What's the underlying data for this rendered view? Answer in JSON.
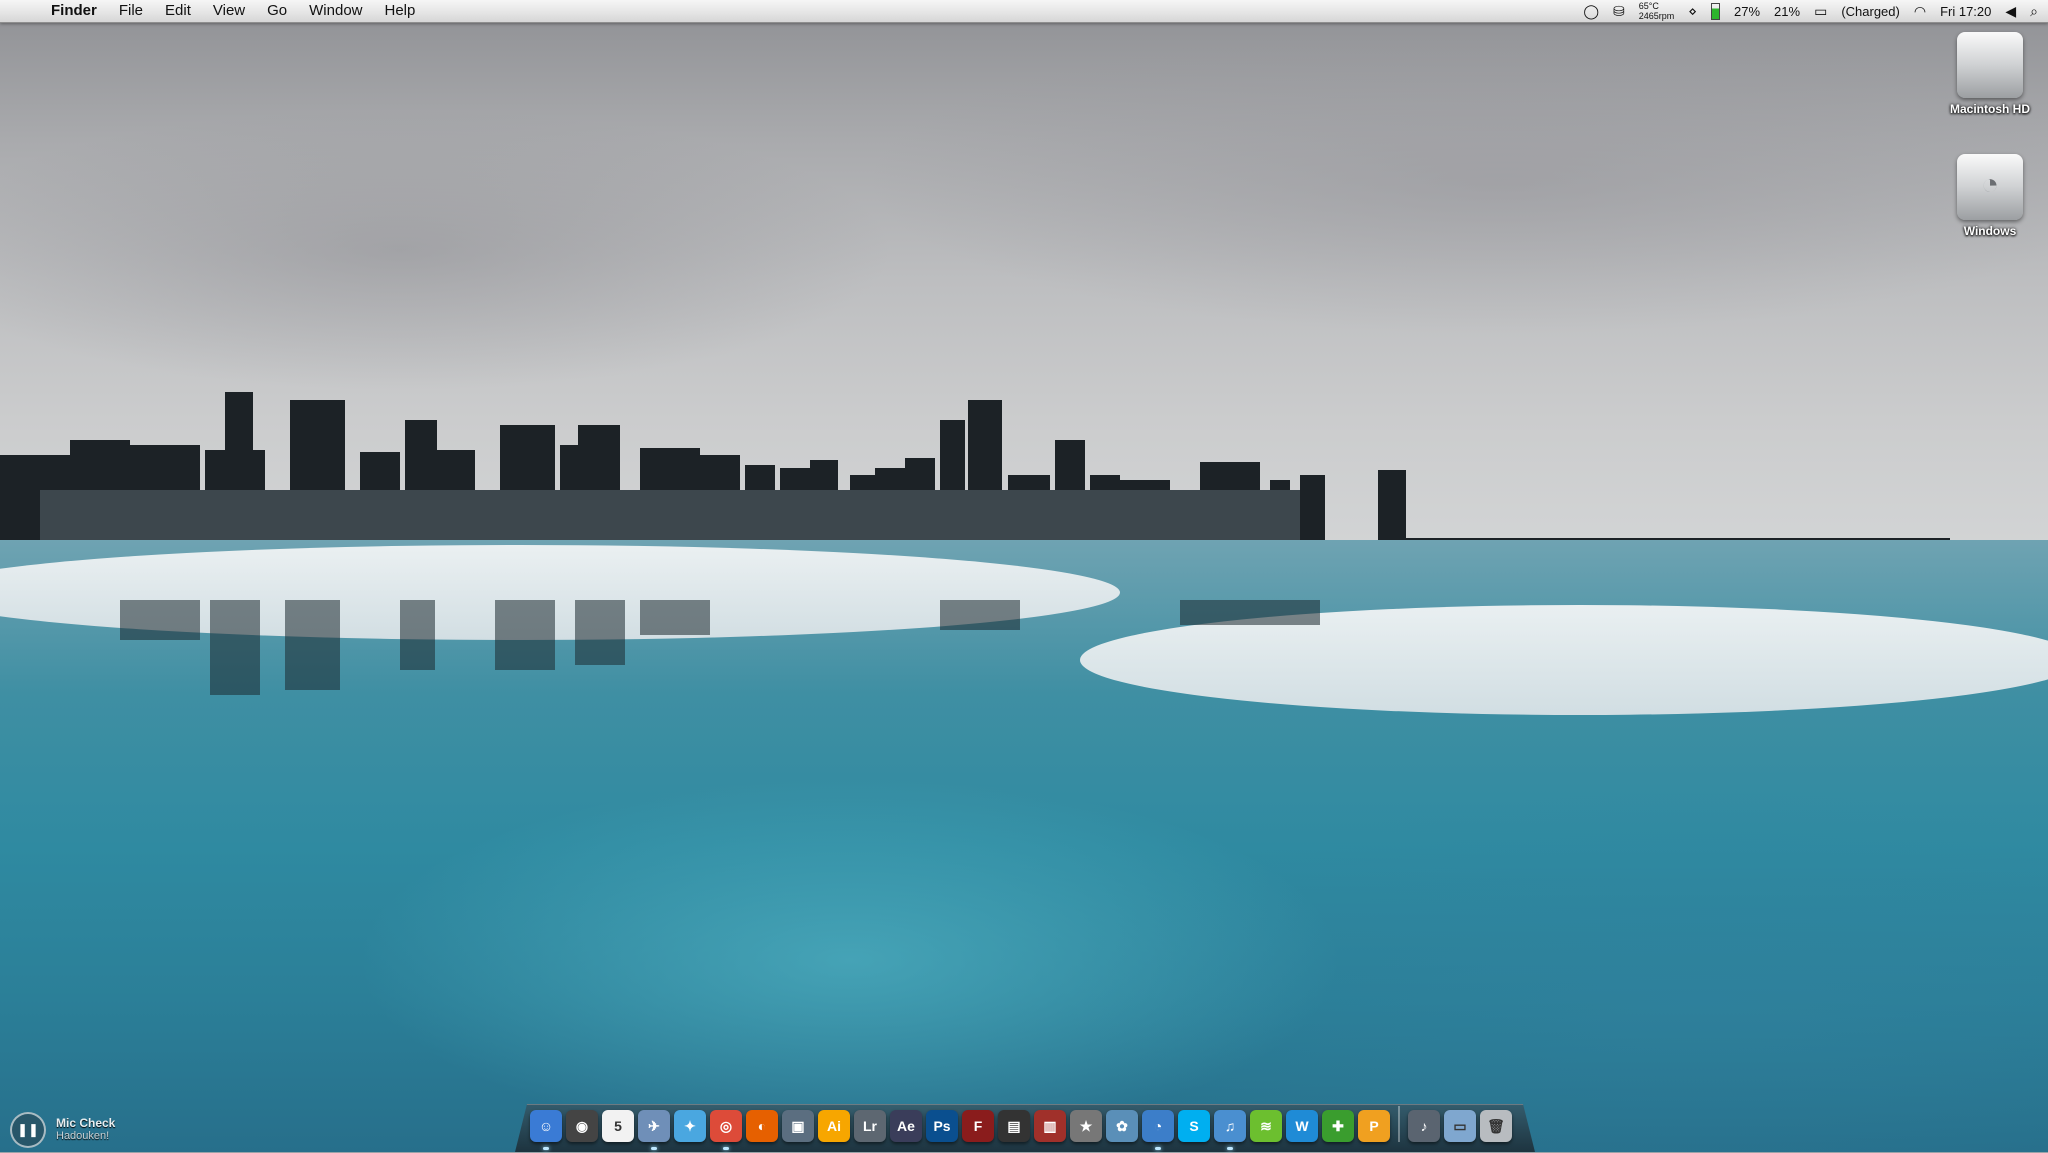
{
  "menubar": {
    "apple_glyph": "",
    "app_name": "Finder",
    "menus": [
      "File",
      "Edit",
      "View",
      "Go",
      "Window",
      "Help"
    ],
    "status": {
      "temperature": "65°C",
      "fan_speed": "2465rpm",
      "cpu_1": "27%",
      "cpu_2": "21%",
      "battery_status": "(Charged)",
      "clock": "Fri 17:20"
    }
  },
  "desktop_icons": [
    {
      "label": "Macintosh HD",
      "icon": "apple-drive-icon"
    },
    {
      "label": "Windows",
      "icon": "windows-drive-icon"
    }
  ],
  "now_playing": {
    "title": "Mic Check",
    "artist": "Hadouken!"
  },
  "dock": {
    "items": [
      {
        "name": "finder",
        "text": "☺",
        "bg": "#3a7bd5",
        "running": true
      },
      {
        "name": "dashboard",
        "text": "◉",
        "bg": "#444",
        "running": false
      },
      {
        "name": "ical",
        "text": "5",
        "bg": "#f2f2f2",
        "running": false
      },
      {
        "name": "mail",
        "text": "✈",
        "bg": "#6f8fb8",
        "running": true
      },
      {
        "name": "safari",
        "text": "✦",
        "bg": "#4aa7e0",
        "running": false
      },
      {
        "name": "chrome",
        "text": "◎",
        "bg": "#dd4b39",
        "running": true
      },
      {
        "name": "firefox",
        "text": "◐",
        "bg": "#e66000",
        "running": false
      },
      {
        "name": "iphoto",
        "text": "▣",
        "bg": "#5b6e80",
        "running": false
      },
      {
        "name": "illustrator",
        "text": "Ai",
        "bg": "#f7a600",
        "running": false
      },
      {
        "name": "lightroom",
        "text": "Lr",
        "bg": "#5d6771",
        "running": false
      },
      {
        "name": "after-effects",
        "text": "Ae",
        "bg": "#3a3d5a",
        "running": false
      },
      {
        "name": "photoshop",
        "text": "Ps",
        "bg": "#0a4f8f",
        "running": false
      },
      {
        "name": "flash",
        "text": "F",
        "bg": "#8a1c1c",
        "running": false
      },
      {
        "name": "final-cut",
        "text": "▤",
        "bg": "#333",
        "running": false
      },
      {
        "name": "photo-booth",
        "text": "▥",
        "bg": "#a0302a",
        "running": false
      },
      {
        "name": "imovie",
        "text": "★",
        "bg": "#777",
        "running": false
      },
      {
        "name": "adium",
        "text": "✿",
        "bg": "#5a8fb8",
        "running": false
      },
      {
        "name": "ichat",
        "text": "◔",
        "bg": "#3c7ec9",
        "running": true
      },
      {
        "name": "skype",
        "text": "S",
        "bg": "#00aff0",
        "running": false
      },
      {
        "name": "itunes",
        "text": "♫",
        "bg": "#4a8fd0",
        "running": true
      },
      {
        "name": "spotify",
        "text": "≋",
        "bg": "#6cbf2f",
        "running": false
      },
      {
        "name": "wunderlist",
        "text": "W",
        "bg": "#1f8bd6",
        "running": false
      },
      {
        "name": "utorrent",
        "text": "✚",
        "bg": "#3a9d2e",
        "running": false
      },
      {
        "name": "pages",
        "text": "P",
        "bg": "#f0a020",
        "running": false
      }
    ],
    "trailing": [
      {
        "name": "music-folder",
        "text": "♪",
        "bg": "#5a6470"
      },
      {
        "name": "documents-folder",
        "text": "▭",
        "bg": "#7fa7cf"
      },
      {
        "name": "trash",
        "text": "🗑",
        "bg": "#b8bcc0"
      }
    ]
  }
}
